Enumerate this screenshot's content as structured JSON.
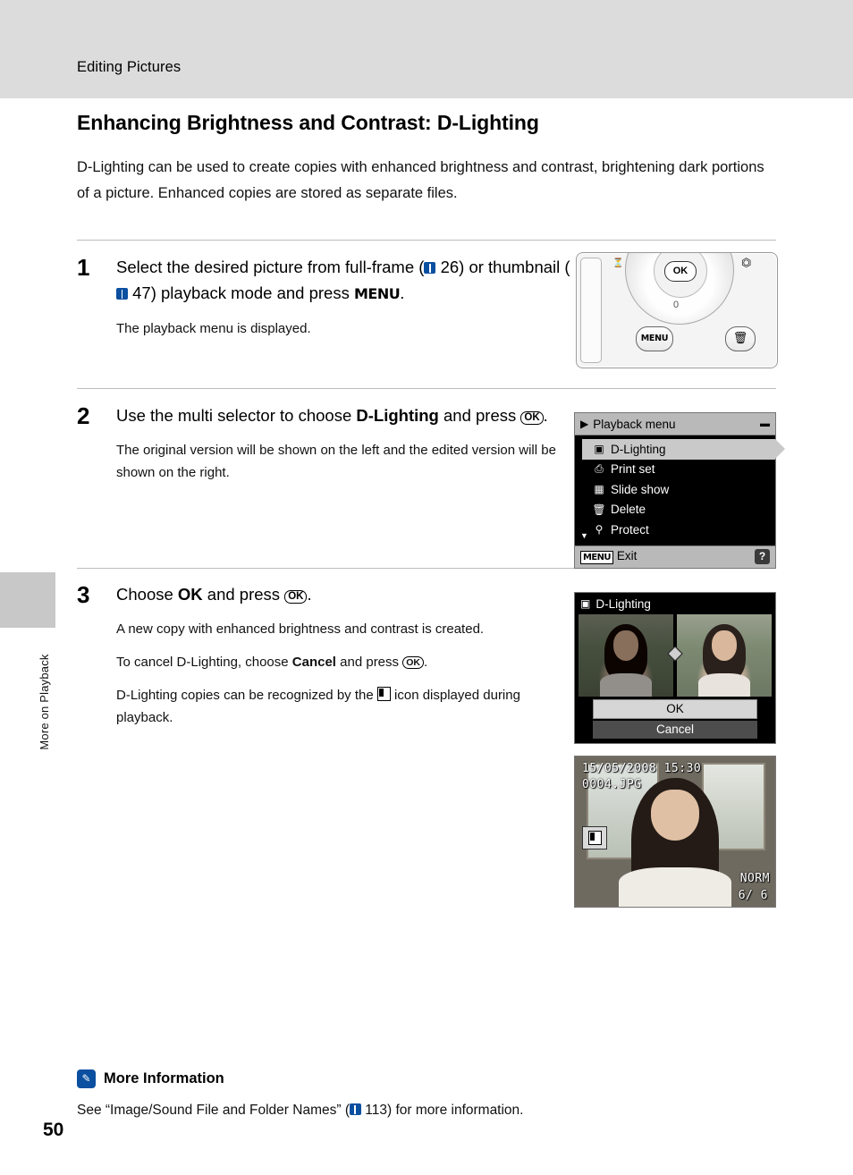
{
  "header": {
    "running_head": "Editing Pictures"
  },
  "side": {
    "chapter_label": "More on Playback"
  },
  "page_number": "50",
  "section": {
    "title": "Enhancing Brightness and Contrast: D-Lighting",
    "intro": "D-Lighting can be used to create copies with enhanced brightness and contrast, brightening dark portions of a picture. Enhanced copies are stored as separate files."
  },
  "steps": [
    {
      "num": "1",
      "head_parts": {
        "a": "Select the desired picture from full-frame (",
        "ref1": "26",
        "b": ") or thumbnail (",
        "ref2": "47",
        "c": ") playback mode and press ",
        "menu": "MENU",
        "d": "."
      },
      "sub": "The playback menu is displayed."
    },
    {
      "num": "2",
      "head_parts": {
        "a": "Use the multi selector to choose ",
        "bold": "D-Lighting",
        "b": " and press ",
        "ok": "OK",
        "c": "."
      },
      "sub": "The original version will be shown on the left and the edited version will be shown on the right."
    },
    {
      "num": "3",
      "head_parts": {
        "a": "Choose ",
        "bold": "OK",
        "b": " and press ",
        "ok": "OK",
        "c": "."
      },
      "sub1": "A new copy with enhanced brightness and contrast is created.",
      "sub2_a": "To cancel D-Lighting, choose ",
      "sub2_bold": "Cancel",
      "sub2_b": " and press ",
      "sub2_ok": "OK",
      "sub2_c": ".",
      "sub3_a": "D-Lighting copies can be recognized by the ",
      "sub3_b": " icon displayed during playback."
    }
  ],
  "camera_figure": {
    "ok_button_label": "OK",
    "menu_button_label": "MENU",
    "trash_icon": "trash-icon",
    "self_timer_icon": "self-timer-icon",
    "exposure_icon": "exposure-compensation-icon"
  },
  "playback_menu": {
    "title": "Playback menu",
    "title_icon": "playback-icon",
    "items": [
      {
        "label": "D-Lighting",
        "icon": "d-lighting-icon",
        "selected": true
      },
      {
        "label": "Print set",
        "icon": "print-set-icon",
        "selected": false
      },
      {
        "label": "Slide show",
        "icon": "slide-show-icon",
        "selected": false
      },
      {
        "label": "Delete",
        "icon": "trash-icon",
        "selected": false
      },
      {
        "label": "Protect",
        "icon": "key-icon",
        "selected": false
      }
    ],
    "footer_badge": "MENU",
    "footer_label": "Exit",
    "help_label": "?"
  },
  "dlighting_screen": {
    "title": "D-Lighting",
    "title_icon": "d-lighting-icon",
    "ok_label": "OK",
    "cancel_label": "Cancel"
  },
  "playback_screen": {
    "date": "15/05/2008  15:30",
    "filename": "0004.JPG",
    "icon": "d-lighting-copy-icon",
    "quality": "NORM",
    "counter": "6/    6"
  },
  "more_information": {
    "badge_icon": "note-icon",
    "title": "More Information",
    "text": "See “Image/Sound File and Folder Names” (",
    "ref": "113",
    "text_after": ") for more information."
  }
}
